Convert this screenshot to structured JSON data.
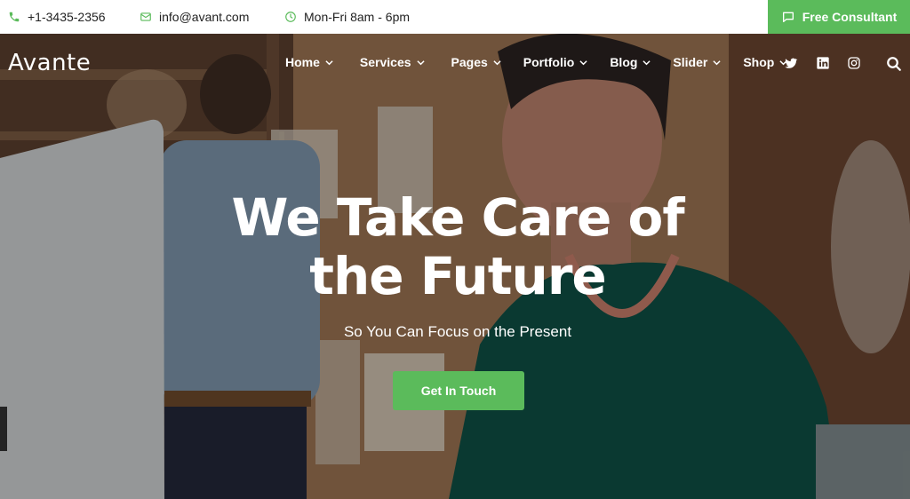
{
  "topbar": {
    "phone": "+1-3435-2356",
    "email": "info@avant.com",
    "hours": "Mon-Fri 8am - 6pm",
    "cta_label": "Free Consultant"
  },
  "brand": {
    "logo": "Avante"
  },
  "nav": {
    "items": [
      "Home",
      "Services",
      "Pages",
      "Portfolio",
      "Blog",
      "Slider",
      "Shop"
    ]
  },
  "social": {
    "icons": [
      "twitter-icon",
      "linkedin-icon",
      "instagram-icon"
    ]
  },
  "hero": {
    "title_line1": "We Take Care of",
    "title_line2": "the Future",
    "subtitle": "So You Can Focus on the Present",
    "button_label": "Get In Touch"
  },
  "colors": {
    "accent": "#5bbb5b",
    "topbar_text": "#222222",
    "hero_text": "#ffffff"
  }
}
